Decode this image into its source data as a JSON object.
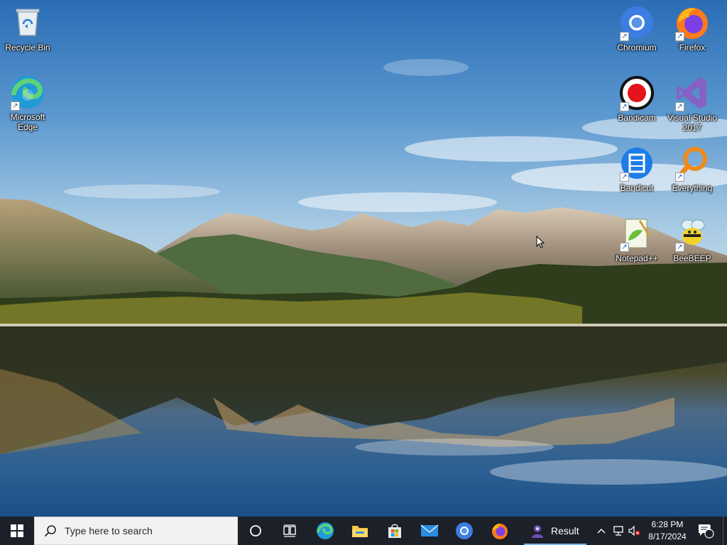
{
  "desktop": {
    "icons": [
      {
        "id": "recycle-bin",
        "label": "Recycle Bin",
        "icon": "recycle-bin-icon"
      },
      {
        "id": "microsoft-edge",
        "label": "Microsoft Edge",
        "icon": "edge-icon"
      },
      {
        "id": "chromium",
        "label": "Chromium",
        "icon": "chromium-icon"
      },
      {
        "id": "firefox",
        "label": "Firefox",
        "icon": "firefox-icon"
      },
      {
        "id": "bandicam",
        "label": "Bandicam",
        "icon": "bandicam-icon"
      },
      {
        "id": "visual-studio",
        "label": "Visual Studio 2017",
        "icon": "visual-studio-icon"
      },
      {
        "id": "bandicut",
        "label": "Bandicut",
        "icon": "bandicut-icon"
      },
      {
        "id": "everything",
        "label": "Everything",
        "icon": "everything-icon"
      },
      {
        "id": "notepadpp",
        "label": "Notepad++",
        "icon": "notepadpp-icon"
      },
      {
        "id": "beebeep",
        "label": "BeeBEEP",
        "icon": "beebeep-icon"
      }
    ]
  },
  "taskbar": {
    "search": {
      "placeholder": "Type here to search"
    },
    "pinned": [
      "cortana-icon",
      "task-view-icon",
      "edge-icon",
      "file-explorer-icon",
      "microsoft-store-icon",
      "mail-icon",
      "chromium-icon",
      "firefox-icon"
    ],
    "running_window": {
      "label": "Result",
      "icon": "app-icon"
    },
    "tray": {
      "time": "6:28 PM",
      "date": "8/17/2024",
      "notification_count": "1"
    }
  },
  "colors": {
    "taskbar_bg": "#1c2029",
    "accent": "#76b9ed"
  }
}
